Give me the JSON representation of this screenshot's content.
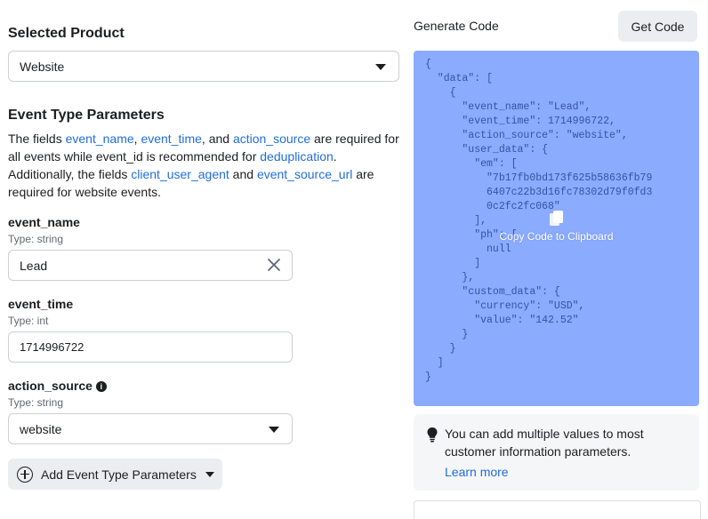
{
  "selected_product": {
    "title": "Selected Product",
    "value": "Website"
  },
  "event_params": {
    "title": "Event Type Parameters",
    "desc": {
      "t1": "The fields ",
      "link_event_name": "event_name",
      "sep1": ", ",
      "link_event_time": "event_time",
      "t2": ", and ",
      "link_action_source": "action_source",
      "t3": " are required for all events while event_id is recommended for ",
      "link_dedup": "deduplication",
      "t4": ". Additionally, the fields ",
      "link_client_user_agent": "client_user_agent",
      "t5": " and ",
      "link_event_source_url": "event_source_url",
      "t6": " are required for website events."
    },
    "fields": [
      {
        "name": "event_name",
        "type": "Type: string",
        "value": "Lead"
      },
      {
        "name": "event_time",
        "type": "Type: int",
        "value": "1714996722"
      },
      {
        "name": "action_source",
        "type": "Type: string",
        "value": "website"
      }
    ],
    "add_button": "Add Event Type Parameters"
  },
  "generate": {
    "title": "Generate Code",
    "button": "Get Code",
    "code": "{\n  \"data\": [\n    {\n      \"event_name\": \"Lead\",\n      \"event_time\": 1714996722,\n      \"action_source\": \"website\",\n      \"user_data\": {\n        \"em\": [\n          \"7b17fb0bd173f625b58636fb79\n          6407c22b3d16fc78302d79f0fd3\n          0c2fc2fc068\"\n        ],\n        \"ph\": [\n          null\n        ]\n      },\n      \"custom_data\": {\n        \"currency\": \"USD\",\n        \"value\": \"142.52\"\n      }\n    }\n  ]\n}",
    "copy_label": "Copy Code to Clipboard"
  },
  "tip": {
    "text": "You can add multiple values to most customer information parameters.",
    "link": "Learn more"
  },
  "colors": {
    "link": "#216fdb",
    "code_bg": "#8aabff",
    "code_text": "#34549f"
  }
}
